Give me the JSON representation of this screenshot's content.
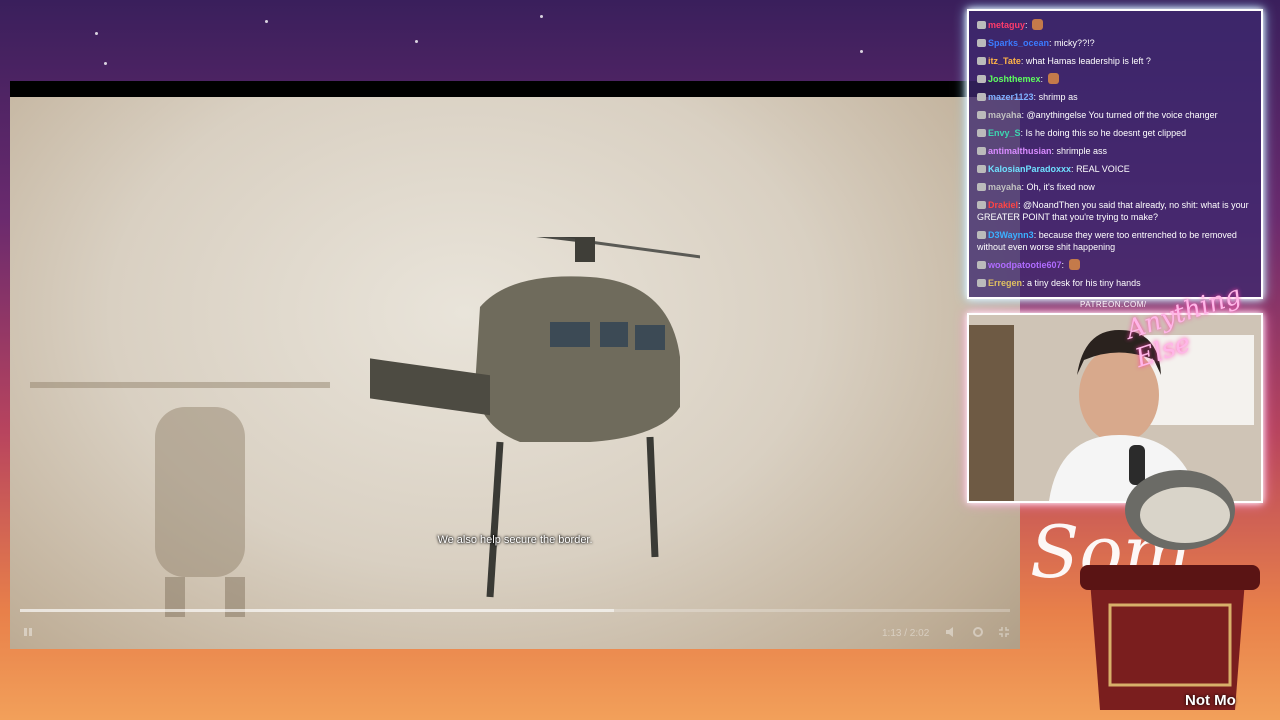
{
  "video": {
    "subtitle": "We also help secure the border.",
    "time": "1:13 / 2:02",
    "progress_fraction": 0.6
  },
  "chat": {
    "messages": [
      {
        "name": "metaguy",
        "color": "#ff3b6b",
        "text": ""
      },
      {
        "name": "Sparks_ocean",
        "color": "#3b7bff",
        "text": "micky??!?"
      },
      {
        "name": "itz_Tate",
        "color": "#ffb347",
        "text": "what Hamas leadership is left ?"
      },
      {
        "name": "Joshthemex",
        "color": "#5cff5c",
        "text": ""
      },
      {
        "name": "mazer1123",
        "color": "#7fb0ff",
        "text": "shrimp as"
      },
      {
        "name": "mayaha",
        "color": "#c0c0c0",
        "text": "@anythingelse You turned off the voice changer"
      },
      {
        "name": "Envy_S",
        "color": "#3dd6b0",
        "text": "Is he doing this so he doesnt get clipped"
      },
      {
        "name": "antimalthusian",
        "color": "#d88cff",
        "text": "shrimple ass"
      },
      {
        "name": "KalosianParadoxxx",
        "color": "#6fe0ff",
        "text": "REAL VOICE"
      },
      {
        "name": "mayaha",
        "color": "#c0c0c0",
        "text": "Oh, it's fixed now"
      },
      {
        "name": "Drakiel",
        "color": "#ff4444",
        "text": "@NoandThen you said that already, no shit: what is your GREATER POINT that you're trying to make?"
      },
      {
        "name": "D3Waynn3",
        "color": "#3bb0ff",
        "text": "because they were too entrenched to be removed without even worse shit happening"
      },
      {
        "name": "woodpatootie607",
        "color": "#b06cff",
        "text": ""
      },
      {
        "name": "Erregen",
        "color": "#e0c060",
        "text": "a tiny desk for his tiny hands"
      }
    ]
  },
  "overlay": {
    "patreon": "PATREON.COM/",
    "logo": "Anything Else",
    "deco": "Som",
    "ticker": "Not Mo"
  }
}
